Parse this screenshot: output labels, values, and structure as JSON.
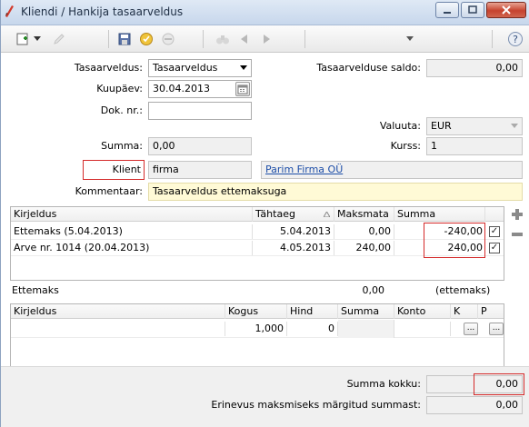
{
  "window": {
    "title": "Kliendi / Hankija tasaarveldus"
  },
  "form": {
    "tasaarveldus_label": "Tasaarveldus:",
    "tasaarveldus_value": "Tasaarveldus",
    "saldo_label": "Tasaarvelduse saldo:",
    "saldo_value": "0,00",
    "kuupaev_label": "Kuupäev:",
    "kuupaev_value": "30.04.2013",
    "dok_label": "Dok. nr.:",
    "dok_value": "",
    "valuuta_label": "Valuuta:",
    "valuuta_value": "EUR",
    "summa_label": "Summa:",
    "summa_value": "0,00",
    "kurss_label": "Kurss:",
    "kurss_value": "1",
    "klient_label": "Klient",
    "klient_value": "firma",
    "klient_name": "Parim Firma OÜ",
    "kommentaar_label": "Kommentaar:",
    "kommentaar_value": "Tasaarveldus ettemaksuga"
  },
  "invoices": {
    "headers": [
      "Kirjeldus",
      "Tähtaeg",
      "Maksmata",
      "Summa"
    ],
    "rows": [
      {
        "kirjeldus": "Ettemaks (5.04.2013)",
        "tahtaeg": "5.04.2013",
        "maksmata": "0,00",
        "summa": "-240,00",
        "checked": true
      },
      {
        "kirjeldus": "Arve nr. 1014 (20.04.2013)",
        "tahtaeg": "4.05.2013",
        "maksmata": "240,00",
        "summa": "240,00",
        "checked": true
      }
    ],
    "check_glyph": "✓"
  },
  "ettemaks": {
    "label": "Ettemaks",
    "value": "0,00",
    "suffix": "(ettemaks)"
  },
  "items": {
    "headers": [
      "Kirjeldus",
      "Kogus",
      "Hind",
      "Summa",
      "Konto",
      "K",
      "P"
    ],
    "row": {
      "kirjeldus": "",
      "kogus": "1,000",
      "hind": "0",
      "summa": "",
      "konto": ""
    },
    "ellipsis": "..."
  },
  "totals": {
    "summa_kokku_label": "Summa kokku:",
    "summa_kokku_value": "0,00",
    "erinevus_label": "Erinevus maksmiseks märgitud summast:",
    "erinevus_value": "0,00"
  },
  "toolbar": {
    "help_glyph": "?"
  },
  "side": {
    "plus": "+",
    "minus": "–"
  },
  "colors": {
    "highlight": "#d42a2a",
    "link": "#1d4ea8",
    "comment_bg": "#fffad6"
  }
}
